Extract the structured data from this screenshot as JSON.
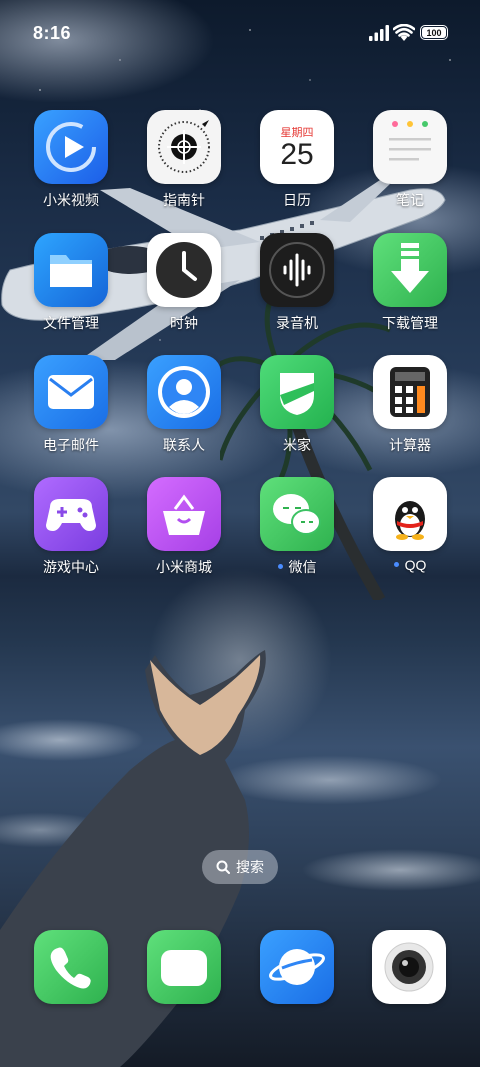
{
  "status_bar": {
    "time": "8:16",
    "battery_level": "100"
  },
  "calendar_icon": {
    "weekday": "星期四",
    "day": "25"
  },
  "apps": [
    {
      "label": "小米视频",
      "icon": "mi-video-icon"
    },
    {
      "label": "指南针",
      "icon": "compass-icon"
    },
    {
      "label": "日历",
      "icon": "calendar-icon"
    },
    {
      "label": "笔记",
      "icon": "notes-icon"
    },
    {
      "label": "文件管理",
      "icon": "folder-icon"
    },
    {
      "label": "时钟",
      "icon": "clock-icon"
    },
    {
      "label": "录音机",
      "icon": "recorder-icon"
    },
    {
      "label": "下载管理",
      "icon": "download-icon"
    },
    {
      "label": "电子邮件",
      "icon": "mail-icon"
    },
    {
      "label": "联系人",
      "icon": "contacts-icon"
    },
    {
      "label": "米家",
      "icon": "mijia-icon"
    },
    {
      "label": "计算器",
      "icon": "calculator-icon"
    },
    {
      "label": "游戏中心",
      "icon": "gamepad-icon"
    },
    {
      "label": "小米商城",
      "icon": "mi-store-icon"
    },
    {
      "label": "微信",
      "icon": "wechat-icon"
    },
    {
      "label": "QQ",
      "icon": "qq-icon"
    }
  ],
  "search": {
    "label": "搜索",
    "icon": "search-icon"
  },
  "dock": [
    {
      "icon": "phone-icon"
    },
    {
      "icon": "messages-icon"
    },
    {
      "icon": "browser-icon"
    },
    {
      "icon": "camera-icon"
    }
  ],
  "colors": {
    "notification_dot": "#4a8cff",
    "calendar_red": "#e53935"
  }
}
